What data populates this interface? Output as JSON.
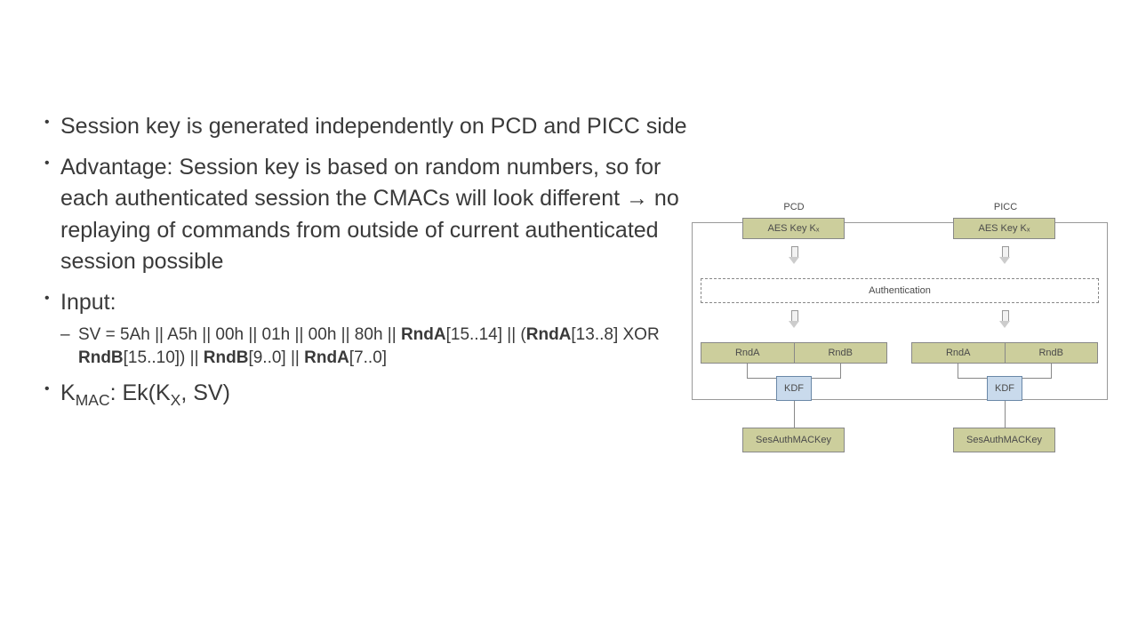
{
  "bullets": {
    "b1": "Session key is generated independently on PCD and PICC side",
    "b2": "Advantage: Session key is based on random numbers, so for each authenticated session the CMACs will look different → no replaying of commands from outside of current authenticated session possible",
    "b3": "Input:",
    "b3_sub_prefix": "SV = 5Ah || A5h || 00h || 01h || 00h || 80h || ",
    "b3_rndA1": "RndA",
    "b3_sub_mid1": "[15..14] || (",
    "b3_rndA2": "RndA",
    "b3_sub_mid2": "[13..8] XOR ",
    "b3_rndB1": "RndB",
    "b3_sub_mid3": "[15..10]) || ",
    "b3_rndB2": "RndB",
    "b3_sub_mid4": "[9..0] || ",
    "b3_rndA3": "RndA",
    "b3_sub_end": "[7..0]",
    "b4_k": "K",
    "b4_mac": "MAC",
    "b4_colon": ": Ek(K",
    "b4_x": "X",
    "b4_end": ", SV)"
  },
  "diagram": {
    "pcd": "PCD",
    "picc": "PICC",
    "aeskey": "AES Key Kₓ",
    "auth": "Authentication",
    "rndA": "RndA",
    "rndB": "RndB",
    "kdf": "KDF",
    "sesmac": "SesAuthMACKey"
  }
}
